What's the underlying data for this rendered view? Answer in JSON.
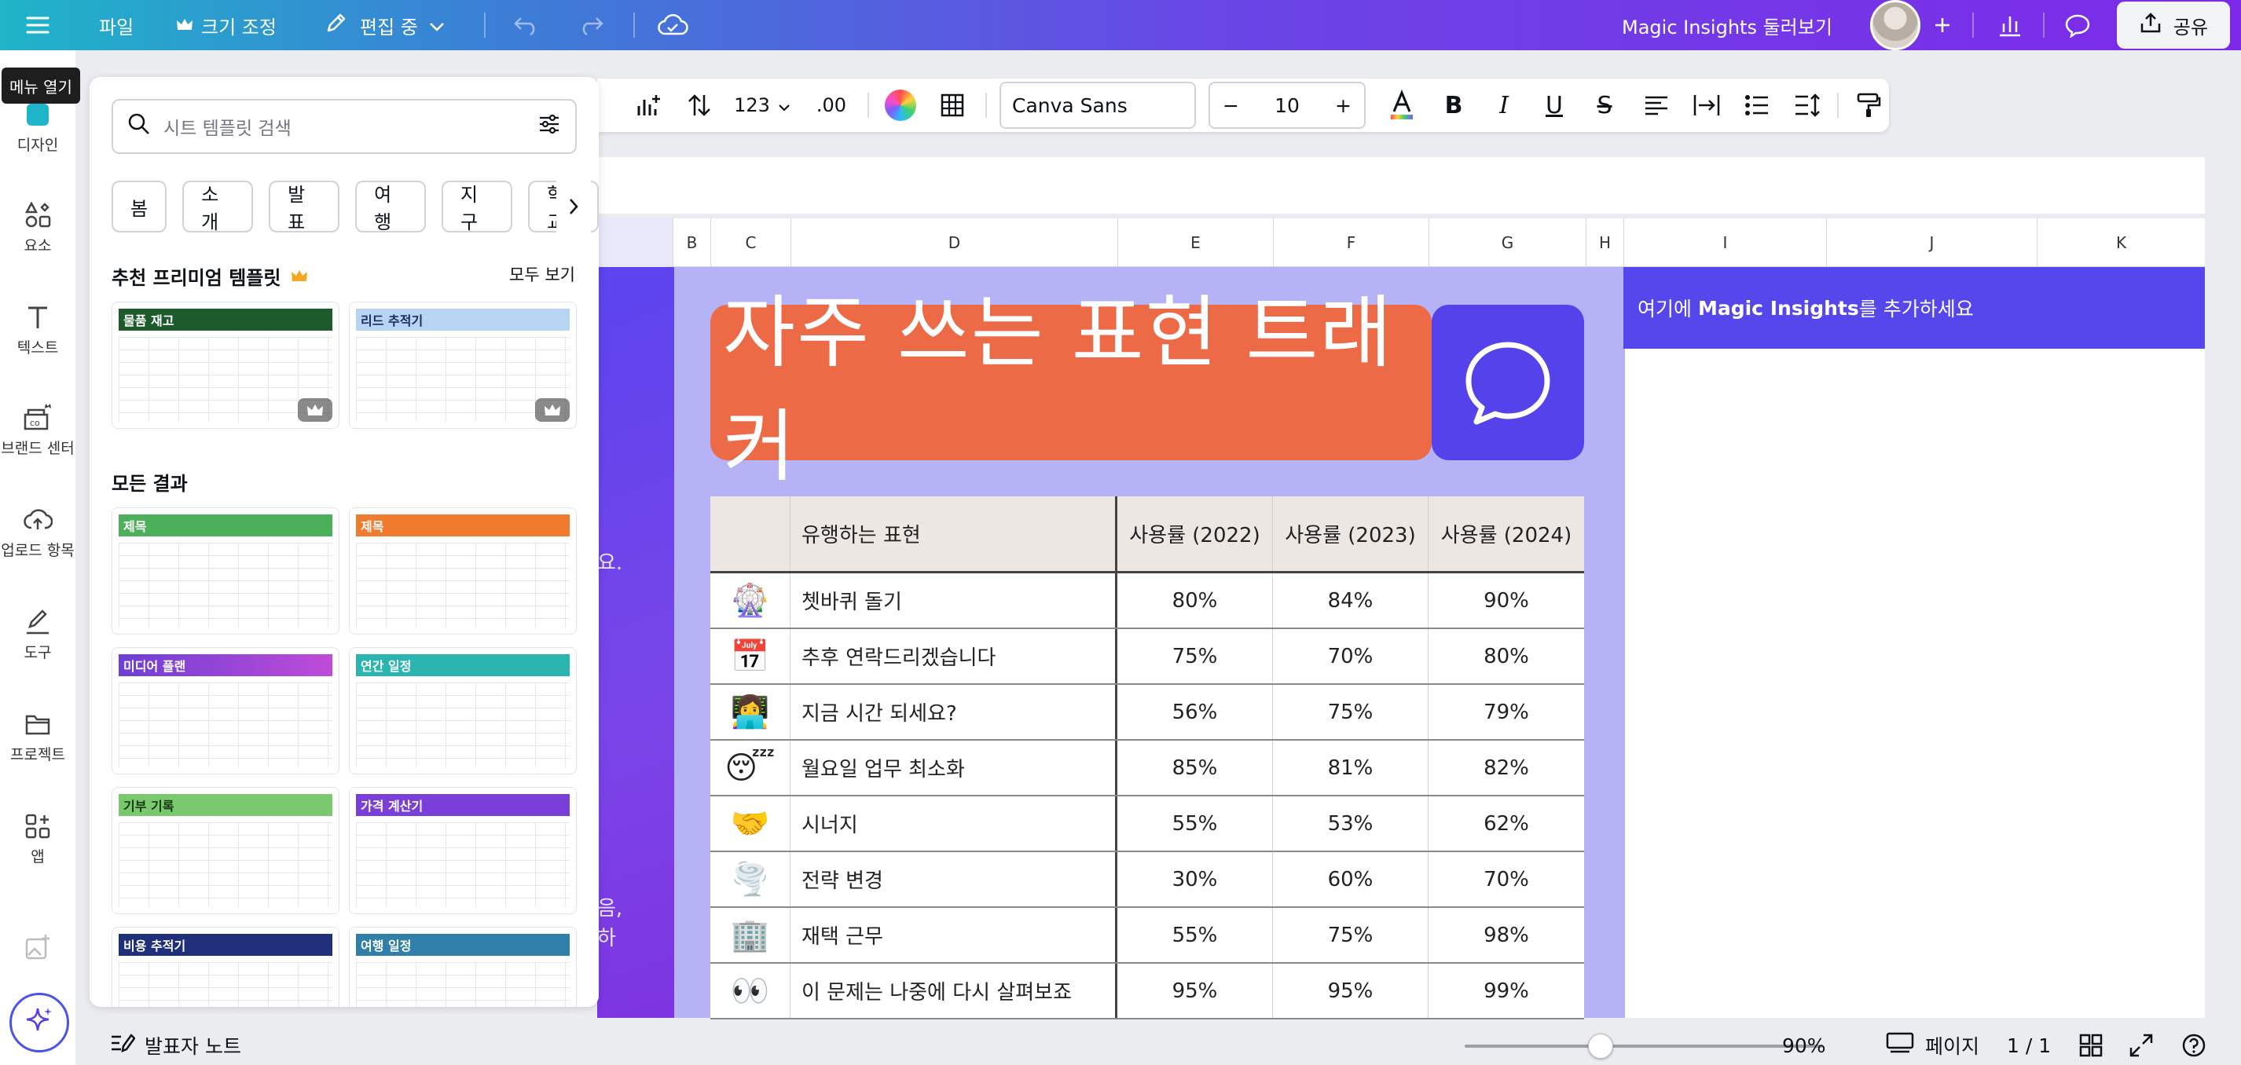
{
  "topbar": {
    "file_label": "파일",
    "resize_label": "크기 조정",
    "editing_label": "편집 중",
    "magic_insights_label": "Magic Insights 둘러보기",
    "share_label": "공유"
  },
  "tooltip": {
    "menu_open": "메뉴 열기"
  },
  "rail": {
    "items": [
      {
        "label": "디자인",
        "icon": "design-icon"
      },
      {
        "label": "요소",
        "icon": "elements-icon"
      },
      {
        "label": "텍스트",
        "icon": "text-icon"
      },
      {
        "label": "브랜드 센터",
        "icon": "brand-icon"
      },
      {
        "label": "업로드 항목",
        "icon": "upload-icon"
      },
      {
        "label": "도구",
        "icon": "draw-icon"
      },
      {
        "label": "프로젝트",
        "icon": "folder-icon"
      },
      {
        "label": "앱",
        "icon": "apps-icon"
      }
    ]
  },
  "panel": {
    "search_placeholder": "시트 템플릿 검색",
    "chips": [
      "봄",
      "소개",
      "발표",
      "여행",
      "지구",
      "학교"
    ],
    "premium_title": "추천 프리미엄 템플릿",
    "see_all": "모두 보기",
    "all_results_title": "모든 결과",
    "premium_templates": [
      {
        "title": "물품 재고",
        "color": "#1d5a2c"
      },
      {
        "title": "리드 추적기",
        "color": "#b7d4f2",
        "text_color": "#1d2a5a"
      }
    ],
    "templates": [
      {
        "title": "제목",
        "color": "#4caf5a"
      },
      {
        "title": "제목",
        "color": "#f07a2e"
      },
      {
        "title": "미디어 플랜",
        "color": "#6c3fd6"
      },
      {
        "title": "연간 일정",
        "color": "#2bb5b0"
      },
      {
        "title": "기부 기록",
        "color": "#7bc96f",
        "text_color": "#173a12"
      },
      {
        "title": "가격 계산기",
        "color": "#7b3fd9"
      },
      {
        "title": "비용 추적기",
        "color": "#1f2f7a"
      },
      {
        "title": "여행 일정",
        "color": "#2f7fa8"
      }
    ]
  },
  "toolbar": {
    "number_format": "123",
    "decimal": ".00",
    "font_name": "Canva Sans",
    "font_size": "10",
    "minus": "−",
    "plus": "+"
  },
  "sheet": {
    "columns": [
      "B",
      "C",
      "D",
      "E",
      "F",
      "G",
      "H",
      "I",
      "J",
      "K"
    ],
    "title": "자주 쓰는 표현 트래커",
    "insights_cell_prefix": "여기에 ",
    "insights_cell_bold": "Magic Insights",
    "insights_cell_suffix": "를 추가하세요",
    "edge_text_1": "요.",
    "edge_text_2": "음,",
    "edge_text_3": "하",
    "table": {
      "headers": [
        "",
        "유행하는 표현",
        "사용률 (2022)",
        "사용률 (2023)",
        "사용률 (2024)"
      ],
      "rows": [
        {
          "emoji": "🎡",
          "expr": "쳇바퀴 돌기",
          "y2022": "80%",
          "y2023": "84%",
          "y2024": "90%"
        },
        {
          "emoji": "📅",
          "expr": "추후 연락드리겠습니다",
          "y2022": "75%",
          "y2023": "70%",
          "y2024": "80%"
        },
        {
          "emoji": "👩‍💻",
          "expr": "지금 시간 되세요?",
          "y2022": "56%",
          "y2023": "75%",
          "y2024": "79%"
        },
        {
          "emoji": "😴",
          "expr": "월요일 업무 최소화",
          "y2022": "85%",
          "y2023": "81%",
          "y2024": "82%"
        },
        {
          "emoji": "🤝",
          "expr": "시너지",
          "y2022": "55%",
          "y2023": "53%",
          "y2024": "62%"
        },
        {
          "emoji": "🌪️",
          "expr": "전략 변경",
          "y2022": "30%",
          "y2023": "60%",
          "y2024": "70%"
        },
        {
          "emoji": "🏢",
          "expr": "재택 근무",
          "y2022": "55%",
          "y2023": "75%",
          "y2024": "98%"
        },
        {
          "emoji": "👀",
          "expr": "이 문제는 나중에 다시 살펴보죠",
          "y2022": "95%",
          "y2023": "95%",
          "y2024": "99%"
        }
      ]
    }
  },
  "bottombar": {
    "presenter_notes": "발표자 노트",
    "zoom": "90%",
    "zoom_fraction": 0.38,
    "pages_label": "페이지",
    "page_indicator": "1 / 1"
  }
}
